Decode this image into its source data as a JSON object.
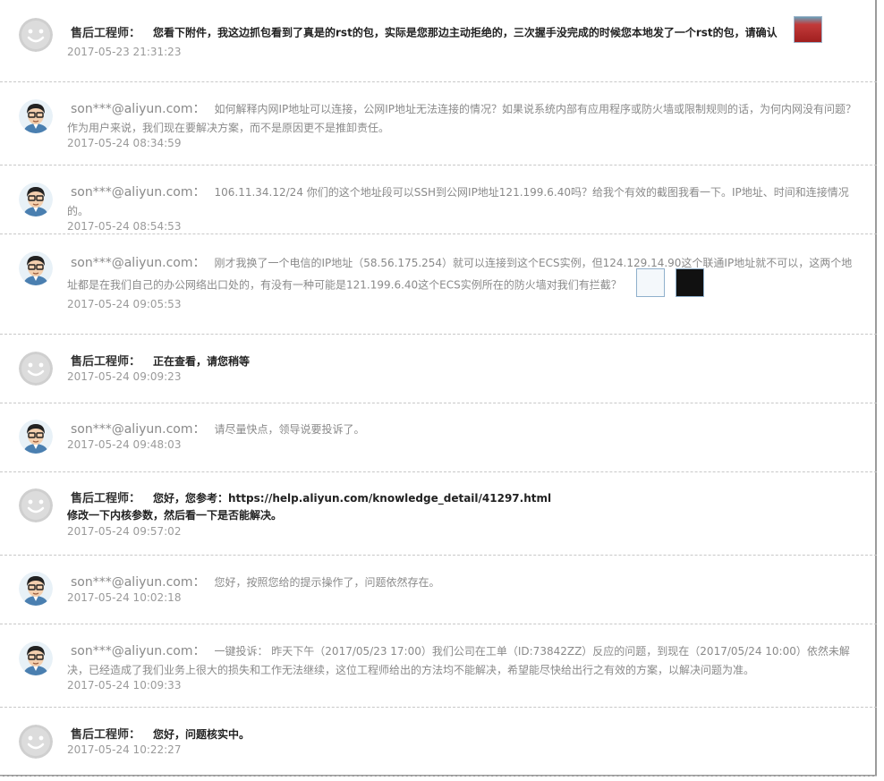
{
  "comments": [
    {
      "author": "售后工程师：",
      "text": "您看下附件，我这边抓包看到了真是的rst的包，实际是您那边主动拒绝的，三次握手没完成的时候您本地发了一个rst的包，请确认",
      "time": "2017-05-23 21:31:23"
    },
    {
      "author": "son***@aliyun.com：",
      "text": "如何解释内网IP地址可以连接，公网IP地址无法连接的情况？如果说系统内部有应用程序或防火墙或限制规则的话，为何内网没有问题？作为用户来说，我们现在要解决方案，而不是原因更不是推卸责任。",
      "time": "2017-05-24 08:34:59"
    },
    {
      "author": "son***@aliyun.com：",
      "text": "106.11.34.12/24 你们的这个地址段可以SSH到公网IP地址121.199.6.40吗？给我个有效的截图我看一下。IP地址、时间和连接情况的。",
      "time": "2017-05-24 08:54:53"
    },
    {
      "author": "son***@aliyun.com：",
      "text": "刚才我换了一个电信的IP地址（58.56.175.254）就可以连接到这个ECS实例，但124.129.14.90这个联通IP地址就不可以，这两个地址都是在我们自己的办公网络出口处的，有没有一种可能是121.199.6.40这个ECS实例所在的防火墙对我们有拦截？",
      "time": "2017-05-24 09:05:53"
    },
    {
      "author": "售后工程师：",
      "text": "正在查看，请您稍等",
      "time": "2017-05-24 09:09:23"
    },
    {
      "author": "son***@aliyun.com：",
      "text": "请尽量快点，领导说要投诉了。",
      "time": "2017-05-24 09:48:03"
    },
    {
      "author": "售后工程师：",
      "text": "您好，您参考：https://help.aliyun.com/knowledge_detail/41297.html",
      "text2": "修改一下内核参数，然后看一下是否能解决。",
      "time": "2017-05-24 09:57:02"
    },
    {
      "author": "son***@aliyun.com：",
      "text": "您好，按照您给的提示操作了，问题依然存在。",
      "time": "2017-05-24 10:02:18"
    },
    {
      "author": "son***@aliyun.com：",
      "text": "一键投诉： 昨天下午（2017/05/23 17:00）我们公司在工单（ID:73842ZZ）反应的问题，到现在（2017/05/24 10:00）依然未解决，已经造成了我们业务上很大的损失和工作无法继续，这位工程师给出的方法均不能解决，希望能尽快给出行之有效的方案，以解决问题为准。",
      "time": "2017-05-24 10:09:33"
    },
    {
      "author": "售后工程师：",
      "text": "您好，问题核实中。",
      "time": "2017-05-24 10:22:27"
    }
  ]
}
